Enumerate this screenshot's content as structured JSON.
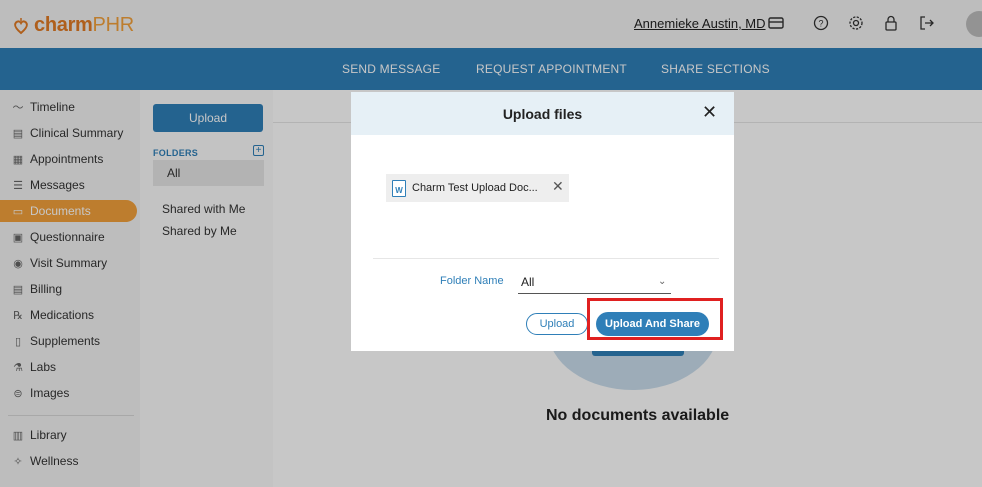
{
  "app": {
    "logo_charm": "charm",
    "logo_phr": "PHR"
  },
  "header": {
    "user_name": "Annemieke Austin, MD",
    "icons": [
      "card-icon",
      "help-icon",
      "settings-icon",
      "lock-icon",
      "logout-icon",
      "avatar"
    ]
  },
  "nav": {
    "items": [
      "SEND MESSAGE",
      "REQUEST APPOINTMENT",
      "SHARE SECTIONS"
    ]
  },
  "sidebar": {
    "items": [
      {
        "label": "Timeline",
        "icon": "timeline-icon"
      },
      {
        "label": "Clinical Summary",
        "icon": "clipboard-icon"
      },
      {
        "label": "Appointments",
        "icon": "calendar-icon"
      },
      {
        "label": "Messages",
        "icon": "message-icon"
      },
      {
        "label": "Documents",
        "icon": "folder-icon",
        "active": true
      },
      {
        "label": "Questionnaire",
        "icon": "questionnaire-icon"
      },
      {
        "label": "Visit Summary",
        "icon": "visit-icon"
      },
      {
        "label": "Billing",
        "icon": "billing-icon"
      },
      {
        "label": "Medications",
        "icon": "rx-icon"
      },
      {
        "label": "Supplements",
        "icon": "supplement-icon"
      },
      {
        "label": "Labs",
        "icon": "flask-icon"
      },
      {
        "label": "Images",
        "icon": "image-icon"
      },
      {
        "label": "Library",
        "icon": "library-icon"
      },
      {
        "label": "Wellness",
        "icon": "wellness-icon"
      }
    ]
  },
  "folders": {
    "upload_label": "Upload",
    "header": "FOLDERS",
    "selected": "All",
    "links": [
      "Shared with Me",
      "Shared by Me"
    ]
  },
  "main": {
    "empty_text": "No documents available"
  },
  "modal": {
    "title": "Upload files",
    "file_name": "Charm Test Upload Doc...",
    "file_icon_letter": "W",
    "folder_label": "Folder Name",
    "folder_value": "All",
    "upload_button": "Upload",
    "upload_share_button": "Upload And Share"
  },
  "colors": {
    "brand_blue": "#2f7fb8",
    "brand_orange": "#f2a13c",
    "highlight_red": "#e02020"
  }
}
